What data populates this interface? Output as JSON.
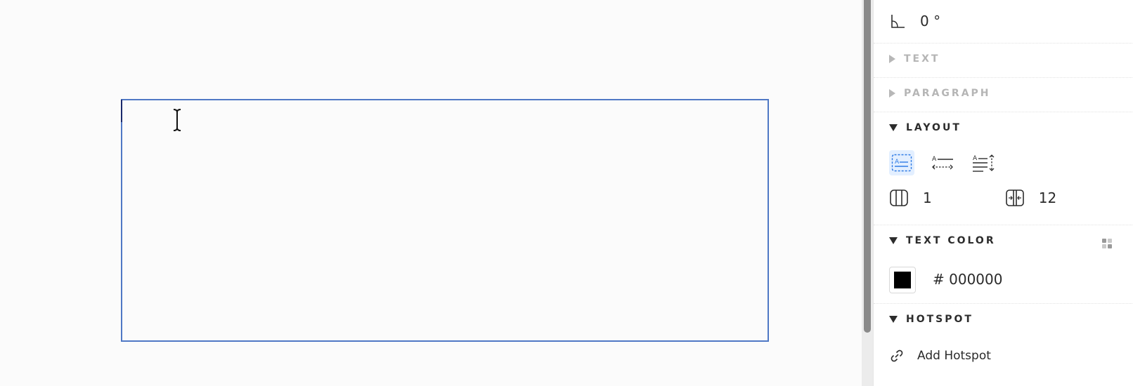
{
  "canvas": {
    "text_frame": {
      "content": ""
    }
  },
  "panel": {
    "rotation": {
      "icon": "angle-icon",
      "value": "0 °"
    },
    "sections": {
      "text": {
        "label": "TEXT",
        "expanded": false
      },
      "paragraph": {
        "label": "PARAGRAPH",
        "expanded": false
      },
      "layout": {
        "label": "LAYOUT",
        "expanded": true
      },
      "text_color": {
        "label": "TEXT COLOR",
        "expanded": true
      },
      "hotspot": {
        "label": "HOTSPOT",
        "expanded": true
      }
    },
    "layout": {
      "modes": [
        {
          "icon": "fixed-box-icon",
          "active": true
        },
        {
          "icon": "auto-width-icon",
          "active": false
        },
        {
          "icon": "auto-height-icon",
          "active": false
        }
      ],
      "columns_icon": "columns-icon",
      "columns": "1",
      "gap_icon": "column-gap-icon",
      "gap": "12"
    },
    "text_color": {
      "hex": "# 000000",
      "swatch_color": "#000000",
      "palette_icon": "palette-icon"
    },
    "hotspot": {
      "icon": "link-icon",
      "label": "Add Hotspot"
    }
  },
  "colors": {
    "accent": "#4f78c5",
    "active_bg": "#e3efff",
    "active_icon": "#2f7be5"
  }
}
